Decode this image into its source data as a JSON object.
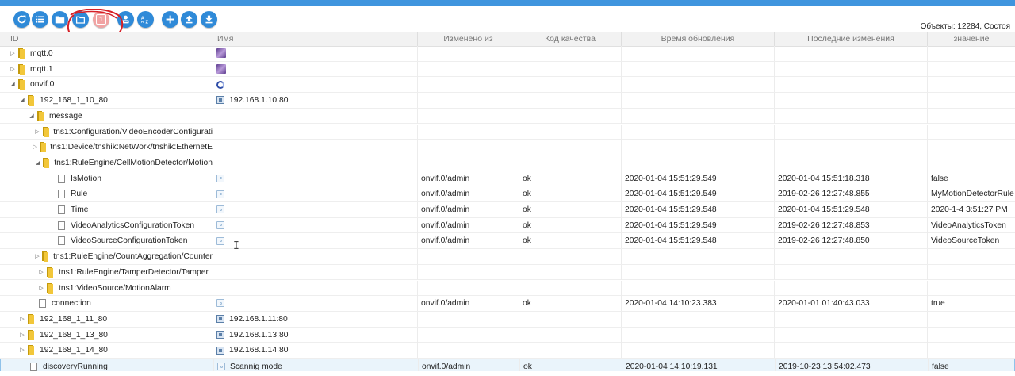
{
  "toolbar": {
    "buttons": [
      {
        "name": "refresh-button",
        "icon": "refresh-icon"
      },
      {
        "name": "list-view-button",
        "icon": "list-icon"
      },
      {
        "name": "folder-view-button",
        "icon": "folder-icon"
      },
      {
        "name": "folder-tree-button",
        "icon": "folder-outline-icon"
      },
      {
        "name": "filter-count-button",
        "icon": "number-badge-icon",
        "label": "1"
      },
      {
        "name": "role-button",
        "icon": "person-tag-icon"
      },
      {
        "name": "sort-az-button",
        "icon": "sort-az-icon"
      },
      {
        "name": "add-button",
        "icon": "plus-icon"
      },
      {
        "name": "upload-button",
        "icon": "upload-icon"
      },
      {
        "name": "download-button",
        "icon": "download-icon"
      }
    ],
    "objects_label": "Объекты: 12284, Состоя"
  },
  "columns": {
    "id": "ID",
    "name": "Имя",
    "changed_from": "Изменено из",
    "quality": "Код качества",
    "update_time": "Время обновления",
    "last_change": "Последние изменения",
    "value": "значение"
  },
  "rows": [
    {
      "id": "mqtt.0",
      "level": 0,
      "type": "folder",
      "expander": "collapsed",
      "name_icon": "mqtt-icon"
    },
    {
      "id": "mqtt.1",
      "level": 0,
      "type": "folder",
      "expander": "collapsed",
      "name_icon": "mqtt-icon"
    },
    {
      "id": "onvif.0",
      "level": 0,
      "type": "folder",
      "expander": "expanded",
      "name_icon": "onvif-icon"
    },
    {
      "id": "192_168_1_10_80",
      "level": 1,
      "type": "folder",
      "expander": "expanded",
      "name_icon": "device-icon",
      "name": "192.168.1.10:80"
    },
    {
      "id": "message",
      "level": 2,
      "type": "folder",
      "expander": "expanded"
    },
    {
      "id": "tns1:Configuration/VideoEncoderConfigurati",
      "level": 3,
      "type": "folder",
      "expander": "collapsed"
    },
    {
      "id": "tns1:Device/tnshik:NetWork/tnshik:EthernetE",
      "level": 3,
      "type": "folder",
      "expander": "collapsed"
    },
    {
      "id": "tns1:RuleEngine/CellMotionDetector/Motion",
      "level": 3,
      "type": "folder",
      "expander": "expanded"
    },
    {
      "id": "IsMotion",
      "level": 4,
      "type": "state",
      "name_icon": "state-icon",
      "from": "onvif.0/admin",
      "quality": "ok",
      "ts": "2020-01-04 15:51:29.549",
      "lc": "2020-01-04 15:51:18.318",
      "value": "false"
    },
    {
      "id": "Rule",
      "level": 4,
      "type": "state",
      "name_icon": "state-icon",
      "from": "onvif.0/admin",
      "quality": "ok",
      "ts": "2020-01-04 15:51:29.549",
      "lc": "2019-02-26 12:27:48.855",
      "value": "MyMotionDetectorRule"
    },
    {
      "id": "Time",
      "level": 4,
      "type": "state",
      "name_icon": "state-icon",
      "from": "onvif.0/admin",
      "quality": "ok",
      "ts": "2020-01-04 15:51:29.548",
      "lc": "2020-01-04 15:51:29.548",
      "value": "2020-1-4 3:51:27 PM"
    },
    {
      "id": "VideoAnalyticsConfigurationToken",
      "level": 4,
      "type": "state",
      "name_icon": "state-icon",
      "from": "onvif.0/admin",
      "quality": "ok",
      "ts": "2020-01-04 15:51:29.549",
      "lc": "2019-02-26 12:27:48.853",
      "value": "VideoAnalyticsToken"
    },
    {
      "id": "VideoSourceConfigurationToken",
      "level": 4,
      "type": "state",
      "name_icon": "state-icon",
      "from": "onvif.0/admin",
      "quality": "ok",
      "ts": "2020-01-04 15:51:29.548",
      "lc": "2019-02-26 12:27:48.850",
      "value": "VideoSourceToken"
    },
    {
      "id": "tns1:RuleEngine/CountAggregation/Counter",
      "level": 3,
      "type": "folder",
      "expander": "collapsed"
    },
    {
      "id": "tns1:RuleEngine/TamperDetector/Tamper",
      "level": 3,
      "type": "folder",
      "expander": "collapsed"
    },
    {
      "id": "tns1:VideoSource/MotionAlarm",
      "level": 3,
      "type": "folder",
      "expander": "collapsed"
    },
    {
      "id": "connection",
      "level": 2,
      "type": "state",
      "name_icon": "state-icon",
      "from": "onvif.0/admin",
      "quality": "ok",
      "ts": "2020-01-04 14:10:23.383",
      "lc": "2020-01-01 01:40:43.033",
      "value": "true"
    },
    {
      "id": "192_168_1_11_80",
      "level": 1,
      "type": "folder",
      "expander": "collapsed",
      "name_icon": "device-icon",
      "name": "192.168.1.11:80"
    },
    {
      "id": "192_168_1_13_80",
      "level": 1,
      "type": "folder",
      "expander": "collapsed",
      "name_icon": "device-icon",
      "name": "192.168.1.13:80"
    },
    {
      "id": "192_168_1_14_80",
      "level": 1,
      "type": "folder",
      "expander": "collapsed",
      "name_icon": "device-icon",
      "name": "192.168.1.14:80"
    },
    {
      "id": "discoveryRunning",
      "level": 1,
      "type": "state",
      "selected": true,
      "name_icon": "state-icon",
      "name": "Scannig mode",
      "from": "onvif.0/admin",
      "quality": "ok",
      "ts": "2020-01-04 14:10:19.131",
      "lc": "2019-10-23 13:54:02.473",
      "value": "false"
    }
  ]
}
